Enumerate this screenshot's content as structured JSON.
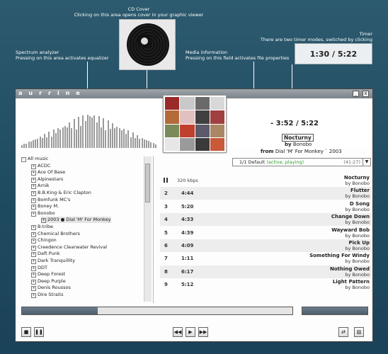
{
  "annotations": {
    "cd_cover": {
      "title": "CD Cover",
      "desc": "Clicking on this area opens cover in your graphic viewer"
    },
    "timer": {
      "title": "Timer",
      "desc": "There are two timer modes, switched by clicking"
    },
    "spectrum": {
      "title": "Spectrum analyzer",
      "desc": "Pressing on this area activates equalizer"
    },
    "media": {
      "title": "Media information",
      "desc": "Pressing on this field activates file properties"
    }
  },
  "timer_big": "1:30 / 5:22",
  "app": {
    "title": "aurrine"
  },
  "window_controls": {
    "minimize": "_",
    "close": "x"
  },
  "now_playing": {
    "time": "- 3:52 / 5:22",
    "title": "Nocturny",
    "by_prefix": "by",
    "artist": "Bonobo",
    "from_prefix": "from",
    "album": "Dial 'M' For Monkey ` 2003"
  },
  "tree": {
    "root": "All music",
    "artists": [
      "ACDC",
      "Ace Of Base",
      "Alpinestars",
      "Arnik",
      "B.B.King & Eric Clapton",
      "Bomfunk MC's",
      "Boney M.",
      "Bonobo"
    ],
    "album": "2003 ● Dial 'M' For Monkey",
    "artists_after": [
      "B-tribe",
      "Chemical Brothers",
      "Chingon",
      "Creedence Clearwater Revival",
      "Daft Punk",
      "Dark Tranquillity",
      "DDT",
      "Deep Forest",
      "Deep Purple",
      "Denis Roussos",
      "Dire Straits"
    ]
  },
  "playlist": {
    "label_prefix": "1/1 Default",
    "label_status": "(active, playing)",
    "duration": "(41:27)",
    "tracks": [
      {
        "num": "",
        "dur": "320 kbps",
        "name": "Nocturny",
        "artist": "by Bonobo"
      },
      {
        "num": "2",
        "dur": "4:44",
        "name": "Flutter",
        "artist": "by Bonobo"
      },
      {
        "num": "3",
        "dur": "5:20",
        "name": "D Song",
        "artist": "by Bonobo"
      },
      {
        "num": "4",
        "dur": "4:33",
        "name": "Change Down",
        "artist": "by Bonobo"
      },
      {
        "num": "5",
        "dur": "4:39",
        "name": "Wayward Bob",
        "artist": "by Bonobo"
      },
      {
        "num": "6",
        "dur": "4:09",
        "name": "Pick Up",
        "artist": "by Bonobo"
      },
      {
        "num": "7",
        "dur": "1:11",
        "name": "Something For Windy",
        "artist": "by Bonobo"
      },
      {
        "num": "8",
        "dur": "6:17",
        "name": "Nothing Owed",
        "artist": "by Bonobo"
      },
      {
        "num": "9",
        "dur": "5:12",
        "name": "Light Pattern",
        "artist": "by Bonobo"
      }
    ]
  },
  "playback": {
    "progress_fraction": 0.28,
    "volume_fraction": 1.0
  },
  "controls": {
    "stop": "■",
    "pause": "❚❚",
    "prev": "◀◀",
    "play": "▶",
    "next": "▶▶",
    "repeat": "⇄",
    "shuffle": "▨"
  },
  "colors": {
    "background": "#2d5a6e",
    "accent": "#4d5e6d",
    "status_green": "#2a9a2a"
  }
}
